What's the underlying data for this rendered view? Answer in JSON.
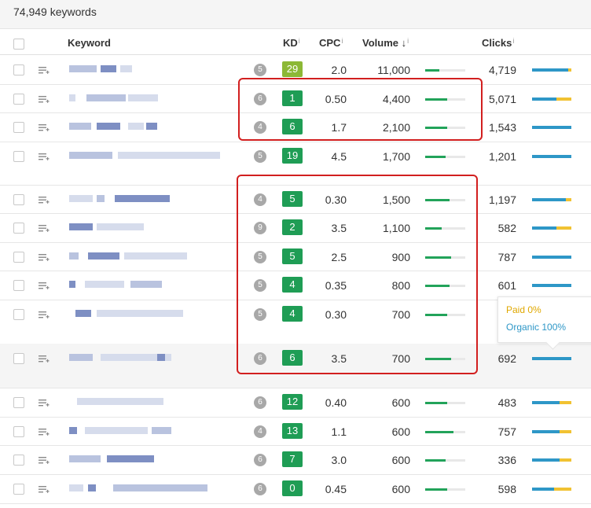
{
  "summary": {
    "keyword_count": "74,949 keywords"
  },
  "columns": {
    "keyword": "Keyword",
    "kd": "KD",
    "cpc": "CPC",
    "volume": "Volume",
    "sort_arrow": "↓",
    "clicks": "Clicks",
    "info_glyph": "i"
  },
  "rows": [
    {
      "rd": "5",
      "kd": "29",
      "cpc": "2.0",
      "volume": "11,000",
      "volume_fraction": 0.35,
      "clicks": "4,719",
      "organic_fraction": 0.92,
      "paid_fraction": 0.08
    },
    {
      "rd": "6",
      "kd": "1",
      "cpc": "0.50",
      "volume": "4,400",
      "volume_fraction": 0.55,
      "clicks": "5,071",
      "organic_fraction": 0.62,
      "paid_fraction": 0.38
    },
    {
      "rd": "4",
      "kd": "6",
      "cpc": "1.7",
      "volume": "2,100",
      "volume_fraction": 0.55,
      "clicks": "1,543",
      "organic_fraction": 1.0,
      "paid_fraction": 0.0
    },
    {
      "rd": "5",
      "kd": "19",
      "cpc": "4.5",
      "volume": "1,700",
      "volume_fraction": 0.5,
      "clicks": "1,201",
      "organic_fraction": 1.0,
      "paid_fraction": 0.0
    },
    {
      "rd": "4",
      "kd": "5",
      "cpc": "0.30",
      "volume": "1,500",
      "volume_fraction": 0.6,
      "clicks": "1,197",
      "organic_fraction": 0.85,
      "paid_fraction": 0.15
    },
    {
      "rd": "9",
      "kd": "2",
      "cpc": "3.5",
      "volume": "1,100",
      "volume_fraction": 0.42,
      "clicks": "582",
      "organic_fraction": 0.62,
      "paid_fraction": 0.38
    },
    {
      "rd": "5",
      "kd": "5",
      "cpc": "2.5",
      "volume": "900",
      "volume_fraction": 0.65,
      "clicks": "787",
      "organic_fraction": 1.0,
      "paid_fraction": 0.0
    },
    {
      "rd": "5",
      "kd": "4",
      "cpc": "0.35",
      "volume": "800",
      "volume_fraction": 0.6,
      "clicks": "601",
      "organic_fraction": 1.0,
      "paid_fraction": 0.0
    },
    {
      "rd": "5",
      "kd": "4",
      "cpc": "0.30",
      "volume": "700",
      "volume_fraction": 0.55,
      "clicks": "",
      "organic_fraction": 1.0,
      "paid_fraction": 0.0
    },
    {
      "rd": "6",
      "kd": "6",
      "cpc": "3.5",
      "volume": "700",
      "volume_fraction": 0.65,
      "clicks": "692",
      "organic_fraction": 1.0,
      "paid_fraction": 0.0
    },
    {
      "rd": "6",
      "kd": "12",
      "cpc": "0.40",
      "volume": "600",
      "volume_fraction": 0.55,
      "clicks": "483",
      "organic_fraction": 0.7,
      "paid_fraction": 0.3
    },
    {
      "rd": "4",
      "kd": "13",
      "cpc": "1.1",
      "volume": "600",
      "volume_fraction": 0.7,
      "clicks": "757",
      "organic_fraction": 0.7,
      "paid_fraction": 0.3
    },
    {
      "rd": "6",
      "kd": "7",
      "cpc": "3.0",
      "volume": "600",
      "volume_fraction": 0.5,
      "clicks": "336",
      "organic_fraction": 0.7,
      "paid_fraction": 0.3
    },
    {
      "rd": "6",
      "kd": "0",
      "cpc": "0.45",
      "volume": "600",
      "volume_fraction": 0.55,
      "clicks": "598",
      "organic_fraction": 0.55,
      "paid_fraction": 0.45
    }
  ],
  "tooltip": {
    "paid": "Paid 0%",
    "organic": "Organic 100%"
  },
  "colors": {
    "kd_green": "#1f9d55",
    "kd_lime": "#8cb836",
    "organic": "#2e97c7",
    "paid": "#f1c232",
    "volume_bar": "#22a35a",
    "highlight": "#d21f1f"
  },
  "icons": {
    "row_action": "add-to-list-icon",
    "sort": "sort-down-icon",
    "info": "info-icon"
  }
}
